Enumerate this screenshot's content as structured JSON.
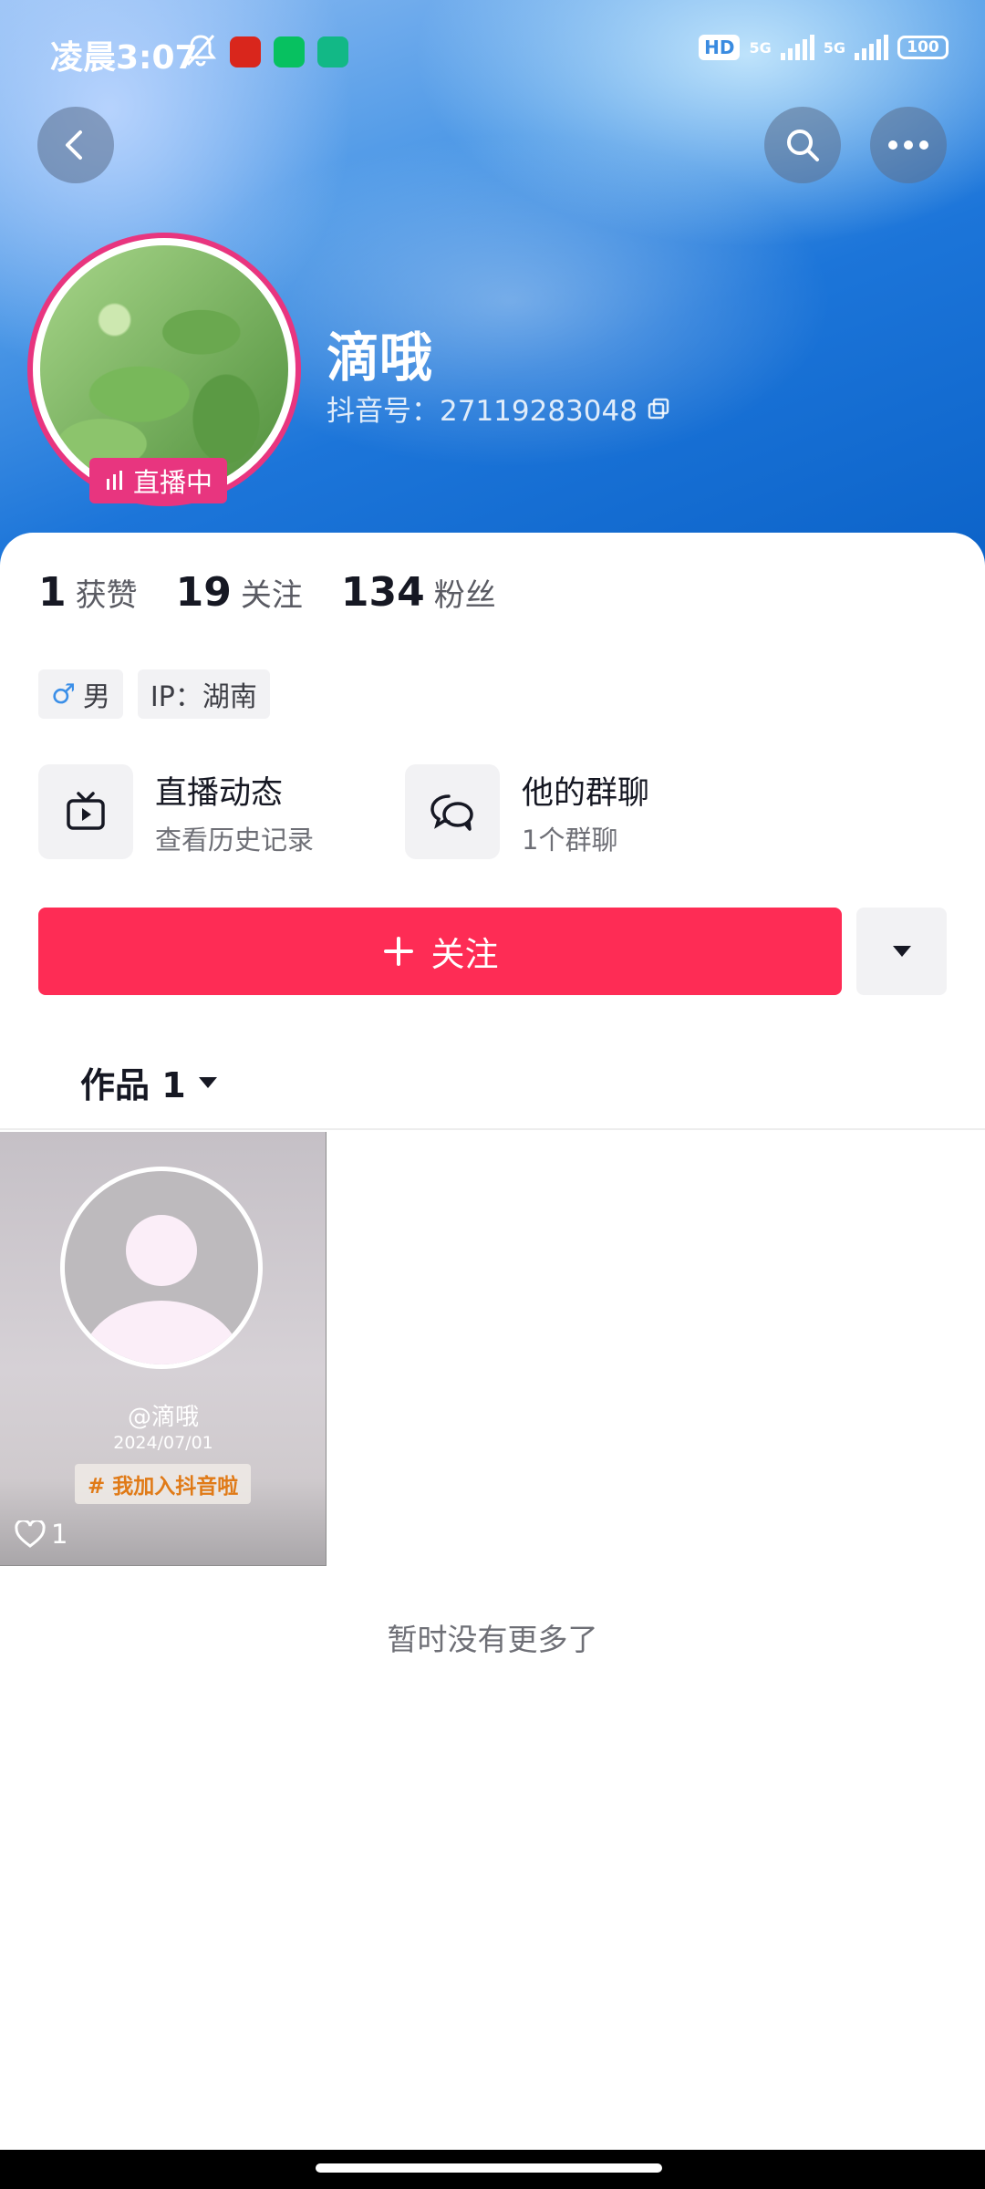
{
  "status_bar": {
    "time": "凌晨3:07",
    "hd_label": "HD",
    "network_1": "5G",
    "network_2": "5G",
    "battery": "100"
  },
  "profile": {
    "nickname": "滴哦",
    "douyin_id": "抖音号：27119283048",
    "live_badge": "直播中"
  },
  "stats": [
    {
      "value": "1",
      "label": "获赞"
    },
    {
      "value": "19",
      "label": "关注"
    },
    {
      "value": "134",
      "label": "粉丝"
    }
  ],
  "tags": {
    "gender": "男",
    "ip": "IP：湖南"
  },
  "features": [
    {
      "title": "直播动态",
      "subtitle": "查看历史记录",
      "icon": "tv-icon"
    },
    {
      "title": "他的群聊",
      "subtitle": "1个群聊",
      "icon": "chat-bubbles-icon"
    }
  ],
  "actions": {
    "follow_label": "关注"
  },
  "works": {
    "tab_label": "作品 1",
    "video": {
      "user": "@滴哦",
      "date": "2024/07/01",
      "hashtag": "# 我加入抖音啦",
      "likes": "1"
    },
    "no_more": "暂时没有更多了"
  },
  "colors": {
    "accent": "#fe2c55",
    "live": "#e8357f"
  }
}
